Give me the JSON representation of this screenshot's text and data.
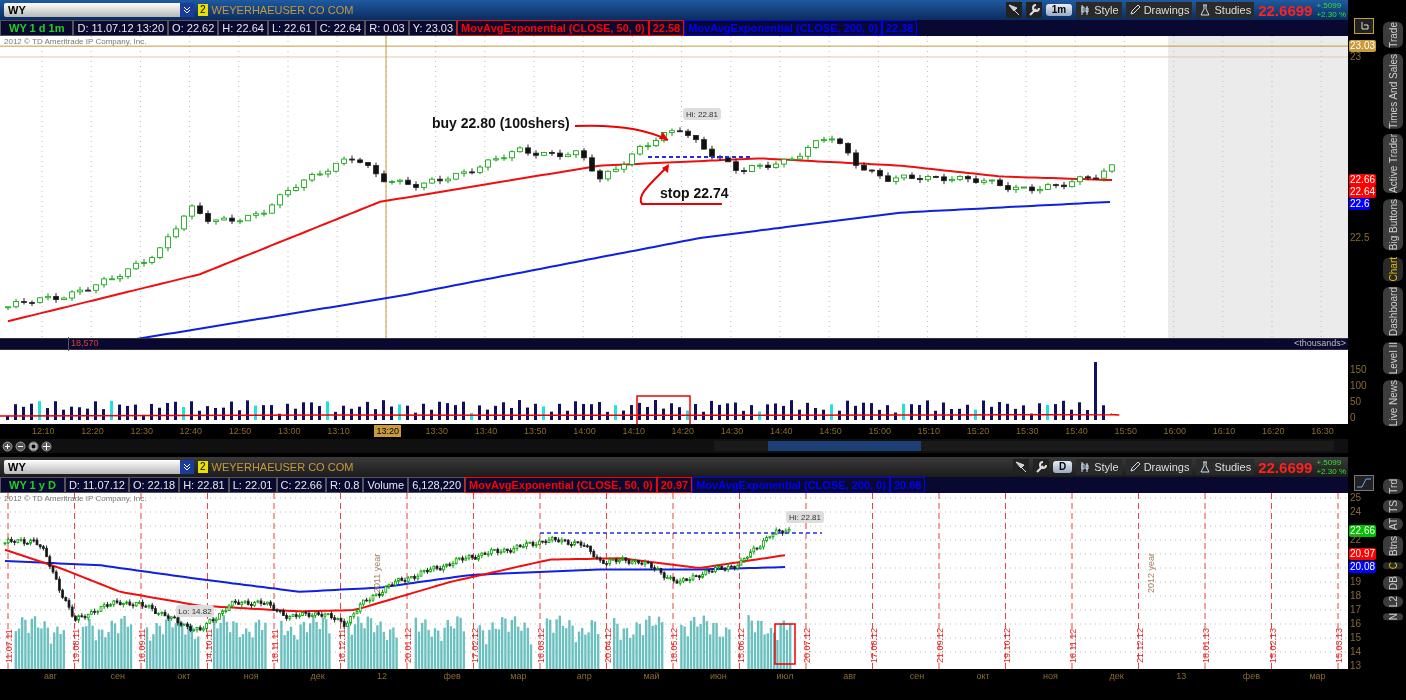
{
  "intraday_chart": {
    "symbol": "WY",
    "link_badge": "2",
    "company": "WEYERHAEUSER CO COM",
    "aggregation": "1m",
    "buttons": [
      "Style",
      "Drawings",
      "Studies"
    ],
    "last_price": "22.6699",
    "change": "+.5099",
    "change_pct": "+2.30 %",
    "info": [
      {
        "text": "WY 1 d 1m",
        "kind": "symbol"
      },
      {
        "text": "D: 11.07.12 13:20",
        "kind": "field"
      },
      {
        "text": "O: 22.62",
        "kind": "field"
      },
      {
        "text": "H: 22.64",
        "kind": "field"
      },
      {
        "text": "L: 22.61",
        "kind": "field"
      },
      {
        "text": "C: 22.64",
        "kind": "field"
      },
      {
        "text": "R: 0.03",
        "kind": "field"
      },
      {
        "text": "Y: 23.03",
        "kind": "field"
      },
      {
        "text": "MovAvgExponential (CLOSE, 50, 0)",
        "kind": "study",
        "color": "#ff0000"
      },
      {
        "text": "22.58",
        "kind": "study",
        "color": "#ff0000"
      },
      {
        "text": "MovAvgExponential (CLOSE, 200, 0)",
        "kind": "study",
        "color": "#0000ff"
      },
      {
        "text": "22.38",
        "kind": "study",
        "color": "#0000ff"
      }
    ],
    "copyright": "2012 © TD Ameritrade IP Company, Inc.",
    "price_labels": [
      {
        "text": "23.03",
        "kind": "badge",
        "color": "#c89a3c"
      },
      {
        "text": "23",
        "kind": "tick"
      },
      {
        "text": "22.66",
        "kind": "badge",
        "color": "#ff0000"
      },
      {
        "text": "22.64",
        "kind": "badge",
        "color": "#ff0000"
      },
      {
        "text": "22.6",
        "kind": "badge",
        "color": "#0000ff"
      },
      {
        "text": "22.5",
        "kind": "tick"
      }
    ],
    "annotations": [
      {
        "text": "buy 22.80 (100shers)",
        "kind": "callout"
      },
      {
        "text": "stop 22.74",
        "kind": "callout"
      },
      {
        "text": "Hi: 22.81",
        "kind": "marker"
      }
    ],
    "volume": {
      "reading": "18,570",
      "units": "<thousands>",
      "labels": [
        "150",
        "100",
        "50",
        "0"
      ]
    },
    "time_labels": [
      {
        "text": "12:10",
        "selected": false
      },
      {
        "text": "12:20",
        "selected": false
      },
      {
        "text": "12:30",
        "selected": false
      },
      {
        "text": "12:40",
        "selected": false
      },
      {
        "text": "12:50",
        "selected": false
      },
      {
        "text": "13:00",
        "selected": false
      },
      {
        "text": "13:10",
        "selected": false
      },
      {
        "text": "13:20",
        "selected": true
      },
      {
        "text": "13:30",
        "selected": false
      },
      {
        "text": "13:40",
        "selected": false
      },
      {
        "text": "13:50",
        "selected": false
      },
      {
        "text": "14:00",
        "selected": false
      },
      {
        "text": "14:10",
        "selected": false
      },
      {
        "text": "14:20",
        "selected": false
      },
      {
        "text": "14:30",
        "selected": false
      },
      {
        "text": "14:40",
        "selected": false
      },
      {
        "text": "14:50",
        "selected": false
      },
      {
        "text": "15:00",
        "selected": false
      },
      {
        "text": "15:10",
        "selected": false
      },
      {
        "text": "15:20",
        "selected": false
      },
      {
        "text": "15:30",
        "selected": false
      },
      {
        "text": "15:40",
        "selected": false
      },
      {
        "text": "15:50",
        "selected": false
      },
      {
        "text": "16:00",
        "selected": false
      },
      {
        "text": "16:10",
        "selected": false
      },
      {
        "text": "16:20",
        "selected": false
      },
      {
        "text": "16:30",
        "selected": false
      }
    ],
    "tabs": [
      {
        "label": "Trade",
        "selected": false
      },
      {
        "label": "Times And Sales",
        "selected": false
      },
      {
        "label": "Active Trader",
        "selected": false
      },
      {
        "label": "Big Buttons",
        "selected": false
      },
      {
        "label": "Chart",
        "selected": true
      },
      {
        "label": "Dashboard",
        "selected": false
      },
      {
        "label": "Level II",
        "selected": false
      },
      {
        "label": "Live News",
        "selected": false
      }
    ]
  },
  "daily_chart": {
    "symbol": "WY",
    "link_badge": "2",
    "company": "WEYERHAEUSER CO COM",
    "aggregation": "D",
    "buttons": [
      "Style",
      "Drawings",
      "Studies"
    ],
    "last_price": "22.6699",
    "change": "+.5099",
    "change_pct": "+2.30 %",
    "info": [
      {
        "text": "WY 1 y D",
        "kind": "symbol"
      },
      {
        "text": "D: 11.07.12",
        "kind": "field"
      },
      {
        "text": "O: 22.18",
        "kind": "field"
      },
      {
        "text": "H: 22.81",
        "kind": "field"
      },
      {
        "text": "L: 22.01",
        "kind": "field"
      },
      {
        "text": "C: 22.66",
        "kind": "field"
      },
      {
        "text": "R: 0.8",
        "kind": "field"
      },
      {
        "text": "Volume",
        "kind": "field"
      },
      {
        "text": "6,128,220",
        "kind": "field"
      },
      {
        "text": "MovAvgExponential (CLOSE, 50, 0)",
        "kind": "study",
        "color": "#ff0000"
      },
      {
        "text": "20.97",
        "kind": "study",
        "color": "#ff0000"
      },
      {
        "text": "MovAvgExponential (CLOSE, 200, 0)",
        "kind": "study",
        "color": "#0000ff"
      },
      {
        "text": "20.08",
        "kind": "study",
        "color": "#0000ff"
      }
    ],
    "copyright": "2012 © TD Ameritrade IP Company, Inc.",
    "price_labels": [
      {
        "text": "25",
        "kind": "tick"
      },
      {
        "text": "24",
        "kind": "tick"
      },
      {
        "text": "22.66",
        "kind": "badge",
        "color": "#00c000"
      },
      {
        "text": "22",
        "kind": "tick"
      },
      {
        "text": "20.97",
        "kind": "badge",
        "color": "#ff0000"
      },
      {
        "text": "20.08",
        "kind": "badge",
        "color": "#0000ff"
      },
      {
        "text": "19",
        "kind": "tick"
      },
      {
        "text": "18",
        "kind": "tick"
      },
      {
        "text": "17",
        "kind": "tick"
      },
      {
        "text": "16",
        "kind": "tick"
      },
      {
        "text": "15",
        "kind": "tick"
      },
      {
        "text": "14",
        "kind": "tick"
      },
      {
        "text": "13",
        "kind": "tick"
      }
    ],
    "annotations": [
      {
        "text": "Hi: 22.81",
        "kind": "marker"
      },
      {
        "text": "Lo: 14.82",
        "kind": "marker"
      }
    ],
    "date_markers": [
      "11.07.11",
      "19.08.11",
      "16.09.11",
      "14.10.11",
      "18.11.11",
      "16.12.11",
      "20.01.12",
      "17.02.12",
      "16.03.12",
      "20.04.12",
      "18.05.12",
      "15.06.12",
      "20.07.12",
      "17.08.12",
      "21.09.12",
      "19.10.12",
      "16.11.12",
      "21.12.12",
      "18.01.13",
      "15.02.13",
      "15.03.13"
    ],
    "year_markers": [
      "2011 year",
      "2012 year"
    ],
    "month_labels": [
      "авг",
      "сен",
      "окт",
      "ноя",
      "дек",
      "12",
      "фев",
      "мар",
      "апр",
      "май",
      "июн",
      "июл",
      "авг",
      "сен",
      "окт",
      "ноя",
      "дек",
      "13",
      "фев",
      "мар"
    ],
    "tabs": [
      {
        "label": "Trd",
        "selected": false
      },
      {
        "label": "TS",
        "selected": false
      },
      {
        "label": "AT",
        "selected": false
      },
      {
        "label": "Btns",
        "selected": false
      },
      {
        "label": "C",
        "selected": true
      },
      {
        "label": "DB",
        "selected": false
      },
      {
        "label": "L2",
        "selected": false
      },
      {
        "label": "N",
        "selected": false
      }
    ]
  }
}
